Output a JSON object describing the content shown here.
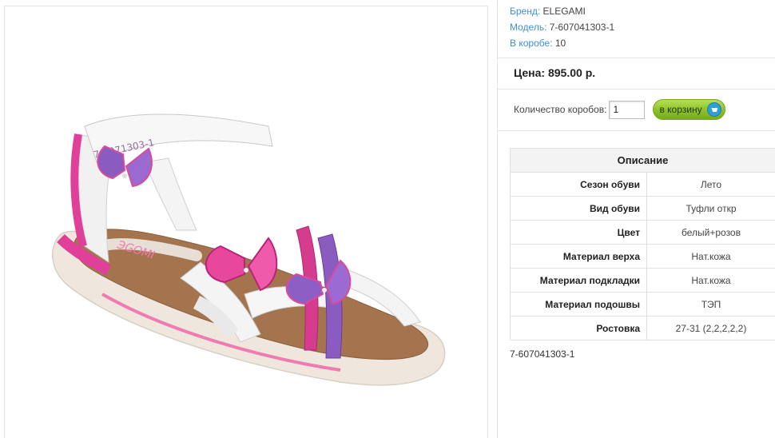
{
  "product": {
    "image_alt": "Детские сандалии",
    "meta": [
      {
        "key": "Бренд:",
        "value": "ELEGAMI"
      },
      {
        "key": "Модель:",
        "value": "7-607041303-1"
      },
      {
        "key": "В коробе:",
        "value": "10"
      }
    ],
    "price_label": "Цена:",
    "price_value": "895.00 р.",
    "qty_label": "Количество коробов:",
    "qty_value": "1",
    "cart_button_label": "в корзину",
    "description": {
      "title": "Описание",
      "rows": [
        {
          "key": "Сезон обуви",
          "value": "Лето"
        },
        {
          "key": "Вид обуви",
          "value": "Туфли откр"
        },
        {
          "key": "Цвет",
          "value": "белый+розов"
        },
        {
          "key": "Материал верха",
          "value": "Нат.кожа"
        },
        {
          "key": "Материал подкладки",
          "value": "Нат.кожа"
        },
        {
          "key": "Материал подошвы",
          "value": "ТЭП"
        },
        {
          "key": "Ростовка",
          "value": "27-31 (2,2,2,2,2)"
        }
      ]
    },
    "sku": "7-607041303-1",
    "insole_print": "ЭGOMI",
    "strap_print": "7-6071303-1"
  }
}
